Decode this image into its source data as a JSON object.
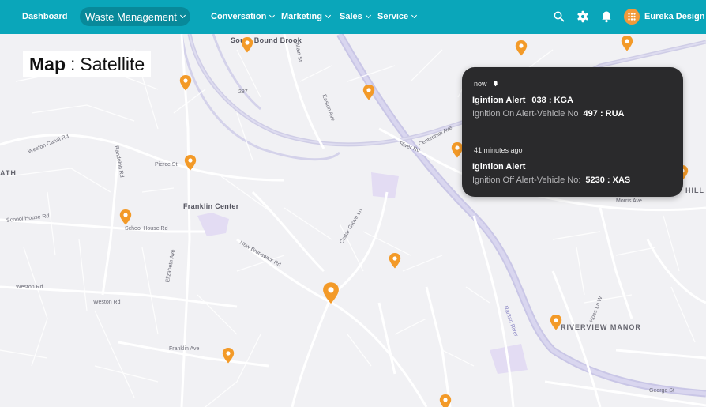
{
  "nav": {
    "dashboard": "Dashboard",
    "waste_management": "Waste Management",
    "conversation": "Conversation",
    "marketing": "Marketing",
    "sales": "Sales",
    "service": "Service",
    "org_name": "Eureka Design"
  },
  "map": {
    "title_bold": "Map",
    "title_sep": ":",
    "title_mode": "Satellite",
    "labels": {
      "south_bound_brook": "South Bound Brook",
      "franklin_center": "Franklin Center",
      "riverview_manor": "RIVERVIEW MANOR",
      "ath": "ATH",
      "hill": "HILL",
      "westons_canal": "Weston Canal Rd",
      "randolph": "Randolph Rd",
      "pierce_st": "Pierce St",
      "school_house": "School House Rd",
      "school_house2": "School House Rd",
      "weston_rd": "Weston Rd",
      "weston_rd2": "Weston Rd",
      "franklin_ave": "Franklin Ave",
      "elizabeth_ave": "Elizabeth Ave",
      "new_brunswick": "New Brunswick Rd",
      "cedar_grove": "Cedar Grove Ln",
      "easton_ave": "Easton Ave",
      "river_rd": "River Rd",
      "centennial_ave": "Centennial Ave",
      "raritan_river": "Raritan River",
      "hoes_ln": "Hoes Ln W",
      "george_st": "George St",
      "morris_ave": "Morris Ave",
      "main_st": "Main St",
      "i287": "287"
    }
  },
  "notification": {
    "items": [
      {
        "time": "now",
        "title": "Igintion Alert",
        "title_value": "038 : KGA",
        "detail": "Ignition On Alert-Vehicle No",
        "detail_value": "497 : RUA"
      },
      {
        "time": "41 minutes ago",
        "title": "Igintion Alert",
        "title_value": "",
        "detail": "Ignition Off Alert-Vehicle No:",
        "detail_value": "5230 : XAS"
      }
    ]
  },
  "colors": {
    "topbar": "#0aa6ba",
    "topbar_active": "#08899a",
    "pin": "#f39a28",
    "popup_bg": "#2a2a2c",
    "org_logo": "#f29a3a"
  }
}
